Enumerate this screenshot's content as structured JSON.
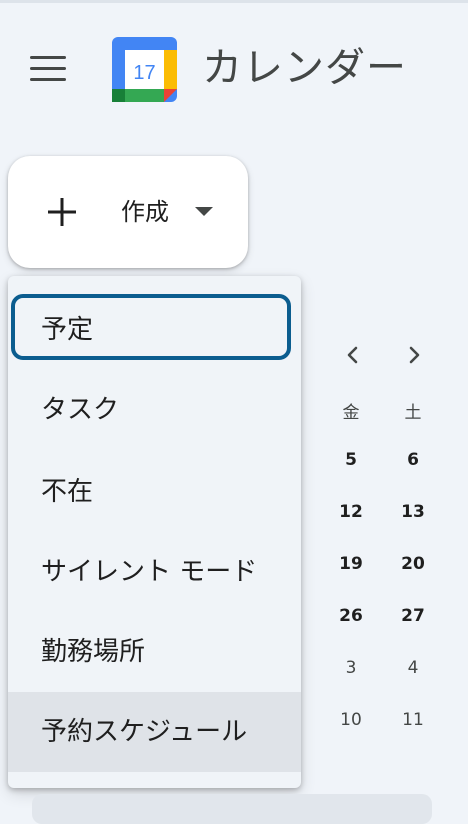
{
  "header": {
    "title": "カレンダー",
    "menu_icon": "hamburger-menu-icon",
    "logo": {
      "icon": "google-calendar-logo",
      "day": "17",
      "colors": {
        "blue": "#4285f4",
        "green": "#34a853",
        "yellow": "#fbbc04",
        "red": "#ea4335"
      }
    }
  },
  "create": {
    "label": "作成",
    "icon": "plus-icon",
    "dropdown_icon": "caret-down-icon"
  },
  "menu": {
    "items": [
      {
        "label": "予定",
        "state": "focused"
      },
      {
        "label": "タスク"
      },
      {
        "label": "不在"
      },
      {
        "label": "サイレント モード"
      },
      {
        "label": "勤務場所"
      },
      {
        "label": "予約スケジュール",
        "state": "hovered"
      }
    ]
  },
  "mini_calendar": {
    "prev_icon": "chevron-left-icon",
    "next_icon": "chevron-right-icon",
    "weekdays": [
      "金",
      "土"
    ],
    "weeks": [
      [
        "5",
        "6"
      ],
      [
        "12",
        "13"
      ],
      [
        "19",
        "20"
      ],
      [
        "26",
        "27"
      ],
      [
        "3",
        "4"
      ],
      [
        "10",
        "11"
      ]
    ]
  },
  "colors": {
    "focus_ring": "#0b5d8f",
    "background": "#f0f4f9"
  }
}
